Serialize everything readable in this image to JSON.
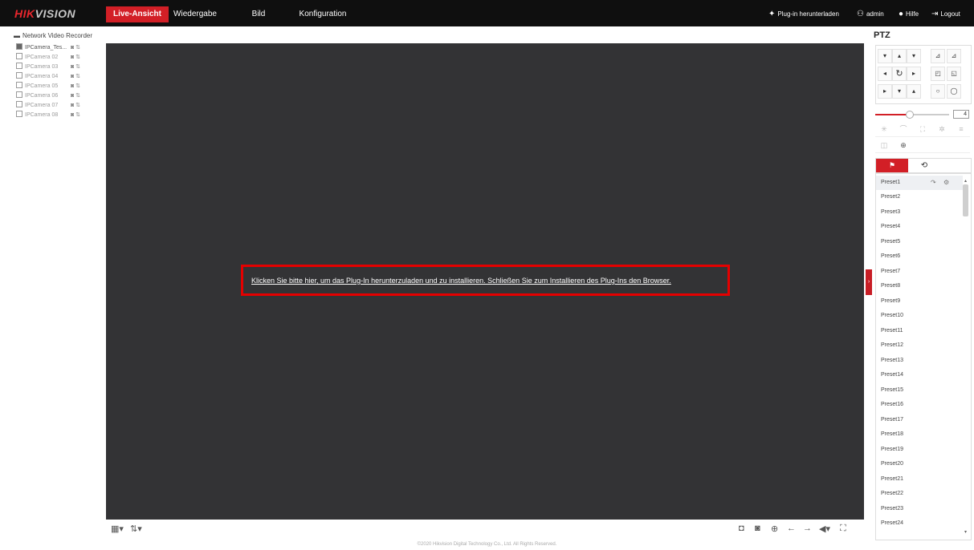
{
  "brand": {
    "part1": "HIK",
    "part2": "VISION"
  },
  "nav": {
    "items": [
      {
        "label": "Live-Ansicht",
        "active": true
      },
      {
        "label": "Wiedergabe",
        "active": false
      },
      {
        "label": "Bild",
        "active": false
      },
      {
        "label": "Konfiguration",
        "active": false
      }
    ]
  },
  "header_tools": {
    "plugin_download": "Plug-in herunterladen",
    "user": "admin",
    "help": "Hilfe",
    "logout": "Logout"
  },
  "sidebar": {
    "root": "Network Video Recorder",
    "cameras": [
      {
        "label": "IPCamera_Tes...",
        "active": true
      },
      {
        "label": "IPCamera 02",
        "active": false
      },
      {
        "label": "IPCamera 03",
        "active": false
      },
      {
        "label": "IPCamera 04",
        "active": false
      },
      {
        "label": "IPCamera 05",
        "active": false
      },
      {
        "label": "IPCamera 06",
        "active": false
      },
      {
        "label": "IPCamera 07",
        "active": false
      },
      {
        "label": "IPCamera 08",
        "active": false
      }
    ]
  },
  "viewer": {
    "plugin_message": "Klicken Sie bitte hier, um das Plug-In herunterzuladen und zu installieren. Schließen Sie zum Installieren des Plug-Ins den Browser."
  },
  "footer": {
    "copyright": "©2020 Hikvision Digital Technology Co., Ltd. All Rights Reserved."
  },
  "ptz": {
    "title": "PTZ",
    "speed": "4",
    "presets": [
      "Preset1",
      "Preset2",
      "Preset3",
      "Preset4",
      "Preset5",
      "Preset6",
      "Preset7",
      "Preset8",
      "Preset9",
      "Preset10",
      "Preset11",
      "Preset12",
      "Preset13",
      "Preset14",
      "Preset15",
      "Preset16",
      "Preset17",
      "Preset18",
      "Preset19",
      "Preset20",
      "Preset21",
      "Preset22",
      "Preset23",
      "Preset24"
    ]
  },
  "colors": {
    "accent": "#d21f26",
    "topbar": "#0f0f0f",
    "video_bg": "#333335",
    "highlight_box": "#e50000"
  }
}
